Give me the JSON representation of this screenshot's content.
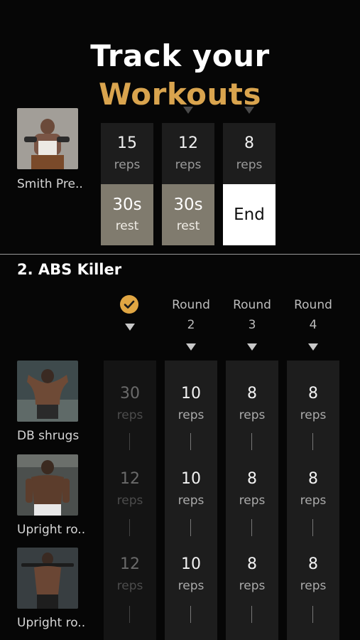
{
  "hero": {
    "line1": "Track your",
    "line2": "Workouts"
  },
  "previous_exercise": {
    "label": "Smith Pre..",
    "sets": [
      {
        "reps": "15",
        "reps_unit": "reps",
        "rest": "30s",
        "rest_unit": "rest"
      },
      {
        "reps": "12",
        "reps_unit": "reps",
        "rest": "30s",
        "rest_unit": "rest"
      },
      {
        "reps": "8",
        "reps_unit": "reps",
        "end": "End"
      }
    ]
  },
  "section": {
    "title": "2. ABS Killer",
    "round_word": "Round",
    "rounds": [
      "2",
      "3",
      "4"
    ],
    "exercises": [
      {
        "label": "DB shrugs",
        "values": [
          "30",
          "10",
          "8",
          "8"
        ]
      },
      {
        "label": "Upright ro..",
        "values": [
          "12",
          "10",
          "8",
          "8"
        ]
      },
      {
        "label": "Upright ro..",
        "values": [
          "12",
          "10",
          "8",
          "8"
        ]
      }
    ],
    "unit": "reps"
  },
  "colors": {
    "accent": "#d9a44e",
    "check": "#e0a643",
    "rest_bg": "#807b6e",
    "column_bg": "#1d1d1d"
  },
  "icons": {
    "check": "check-circle-icon",
    "marker": "triangle-down-icon"
  }
}
